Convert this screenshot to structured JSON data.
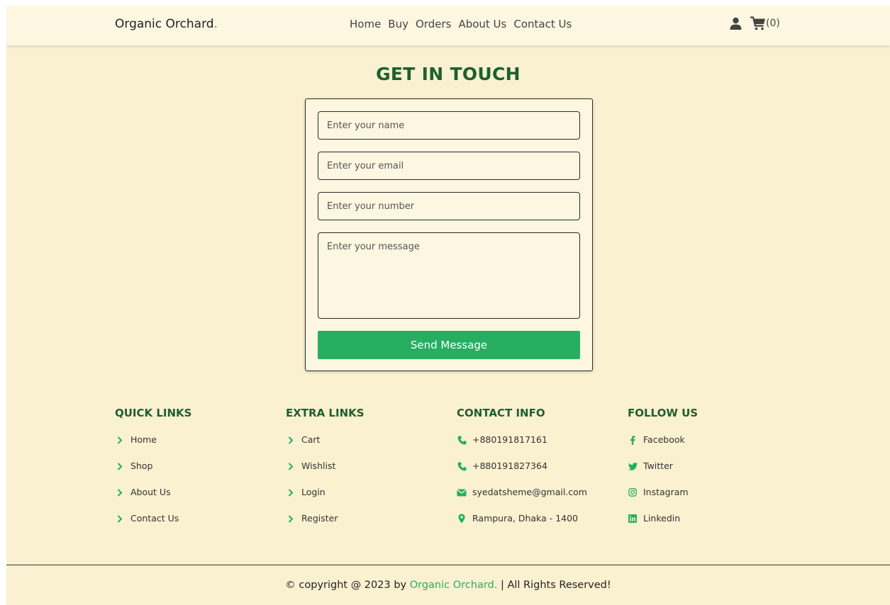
{
  "header": {
    "logo": "Organic Orchard",
    "logo_dot": ".",
    "nav": [
      "Home",
      "Buy",
      "Orders",
      "About Us",
      "Contact Us"
    ],
    "user_icon": "user-icon",
    "cart_icon": "shopping-cart-icon",
    "cart_count": "(0)"
  },
  "contact": {
    "title": "GET IN TOUCH",
    "name_placeholder": "Enter your name",
    "email_placeholder": "Enter your email",
    "number_placeholder": "Enter your number",
    "message_placeholder": "Enter your message",
    "send_label": "Send Message"
  },
  "footer": {
    "quick_links": {
      "title": "QUICK LINKS",
      "items": [
        "Home",
        "Shop",
        "About Us",
        "Contact Us"
      ]
    },
    "extra_links": {
      "title": "EXTRA LINKS",
      "items": [
        "Cart",
        "Wishlist",
        "Login",
        "Register"
      ]
    },
    "contact_info": {
      "title": "CONTACT INFO",
      "items": [
        "+880191817161",
        "+880191827364",
        "syedatsheme@gmail.com",
        "Rampura, Dhaka - 1400"
      ]
    },
    "follow_us": {
      "title": "FOLLOW US",
      "items": [
        "Facebook",
        "Twitter",
        "Instagram",
        "Linkedin"
      ]
    },
    "copyright_prefix": "© copyright @ 2023 by ",
    "copyright_brand": "Organic Orchard.",
    "copyright_suffix": " | All Rights Reserved!"
  },
  "colors": {
    "accent_green": "#27ae60",
    "heading_green": "#1e5f2e",
    "background": "#faf1d1"
  }
}
